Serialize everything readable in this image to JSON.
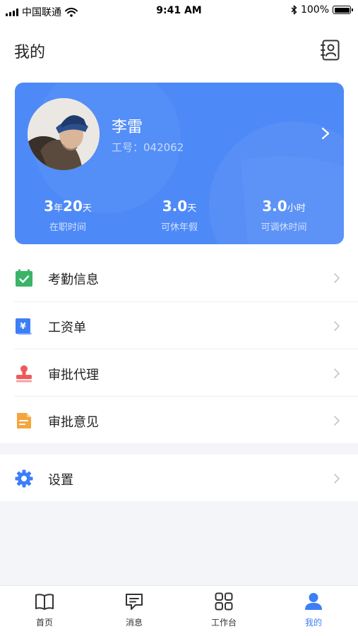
{
  "status_bar": {
    "carrier": "中国联通",
    "time": "9:41 AM",
    "battery": "100%"
  },
  "header": {
    "title": "我的",
    "contact_icon": "contact-card-icon"
  },
  "profile": {
    "name": "李雷",
    "employee_id": "工号：042062",
    "avatar_icon": "user-avatar",
    "stats": [
      {
        "value": "3",
        "unit": "年",
        "value2": "20",
        "unit2": "天",
        "label": "在职时间"
      },
      {
        "value": "3.0",
        "unit": "天",
        "label": "可休年假"
      },
      {
        "value": "3.0",
        "unit": "小时",
        "label": "可调休时间"
      }
    ]
  },
  "menu": [
    {
      "label": "考勤信息",
      "icon": "calendar-check-icon",
      "color": "#3ab367"
    },
    {
      "label": "工资单",
      "icon": "salary-slip-icon",
      "color": "#3d7ef6"
    },
    {
      "label": "审批代理",
      "icon": "stamp-icon",
      "color": "#ee5a5a"
    },
    {
      "label": "审批意见",
      "icon": "document-note-icon",
      "color": "#f5a53c"
    }
  ],
  "settings": {
    "label": "设置",
    "icon": "gear-icon",
    "color": "#3d7ef6"
  },
  "tabs": [
    {
      "label": "首页",
      "icon": "book-icon",
      "active": false
    },
    {
      "label": "消息",
      "icon": "message-icon",
      "active": false
    },
    {
      "label": "工作台",
      "icon": "grid-icon",
      "active": false
    },
    {
      "label": "我的",
      "icon": "person-icon",
      "active": true
    }
  ],
  "colors": {
    "accent": "#3d7ef6",
    "card": "#4e8af7",
    "background": "#f4f5f8"
  }
}
